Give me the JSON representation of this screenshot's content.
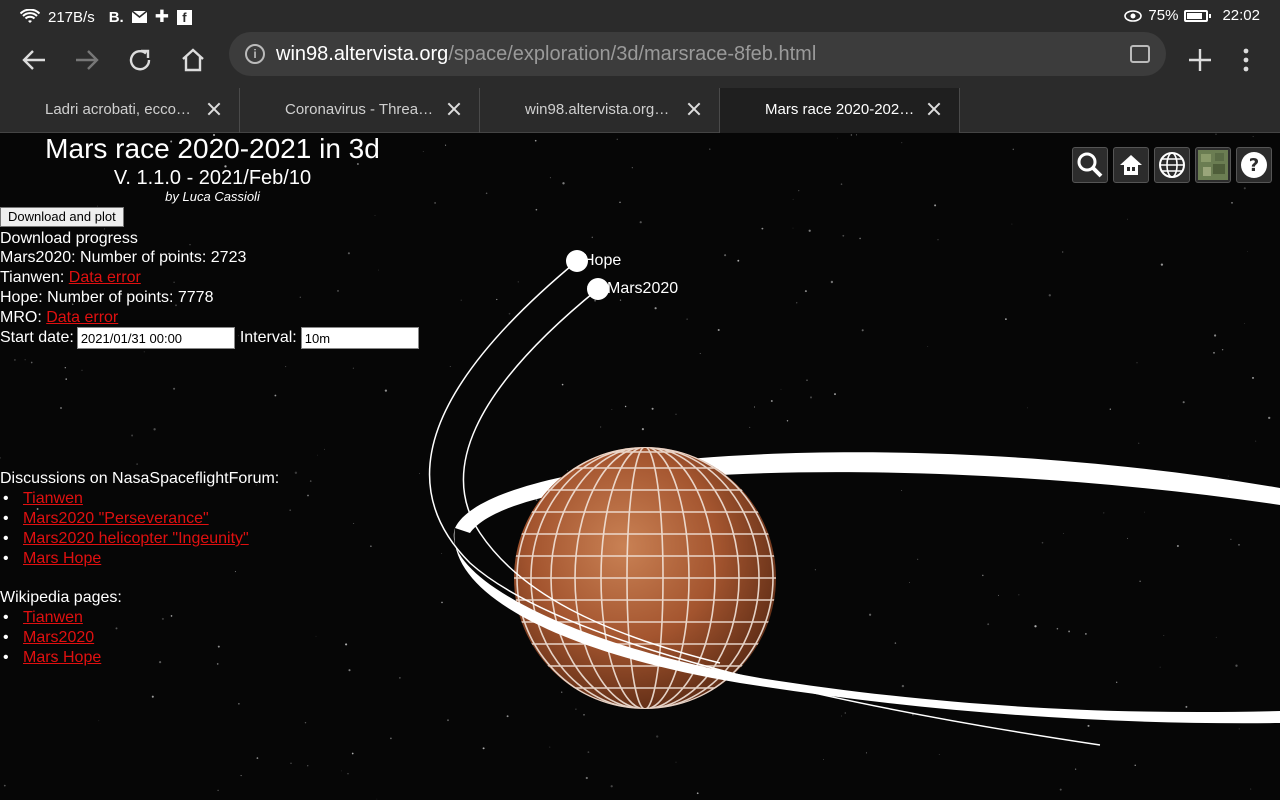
{
  "statusbar": {
    "network_speed": "217B/s",
    "notif_b": "B.",
    "battery": "75%",
    "time": "22:02"
  },
  "toolbar": {
    "url_host": "win98.altervista.org",
    "url_path": "/space/exploration/3d/marsrace-8feb.html"
  },
  "tabs": [
    {
      "title": "Ladri acrobati, ecco…",
      "active": false
    },
    {
      "title": "Coronavirus - Threa…",
      "active": false
    },
    {
      "title": "win98.altervista.org…",
      "active": false
    },
    {
      "title": "Mars race 2020-202…",
      "active": true
    }
  ],
  "page": {
    "title": "Mars race 2020-2021 in 3d",
    "version": "V. 1.1.0 - 2021/Feb/10",
    "author": "by Luca Cassioli",
    "download_button": "Download and plot",
    "progress_label": "Download progress",
    "mars2020": "Mars2020: Number of points: 2723",
    "tianwen_label": "Tianwen: ",
    "tianwen_status": "Data error",
    "hope": "Hope: Number of points: 7778",
    "mro_label": "MRO: ",
    "mro_status": "Data error",
    "start_date_label": "Start date:",
    "start_date_value": "2021/01/31 00:00",
    "interval_label": "Interval:",
    "interval_value": "10m",
    "forum_title": "Discussions on NasaSpaceflightForum:",
    "forum_links": [
      "Tianwen",
      "Mars2020 \"Perseverance\"",
      "Mars2020 helicopter \"Ingeunity\"",
      "Mars Hope"
    ],
    "wiki_title": "Wikipedia pages:",
    "wiki_links": [
      "Tianwen",
      "Mars2020",
      "Mars Hope"
    ]
  },
  "scene": {
    "label_hope": "Hope",
    "label_mars2020": "Mars2020",
    "planet_color": "#b5633a"
  }
}
